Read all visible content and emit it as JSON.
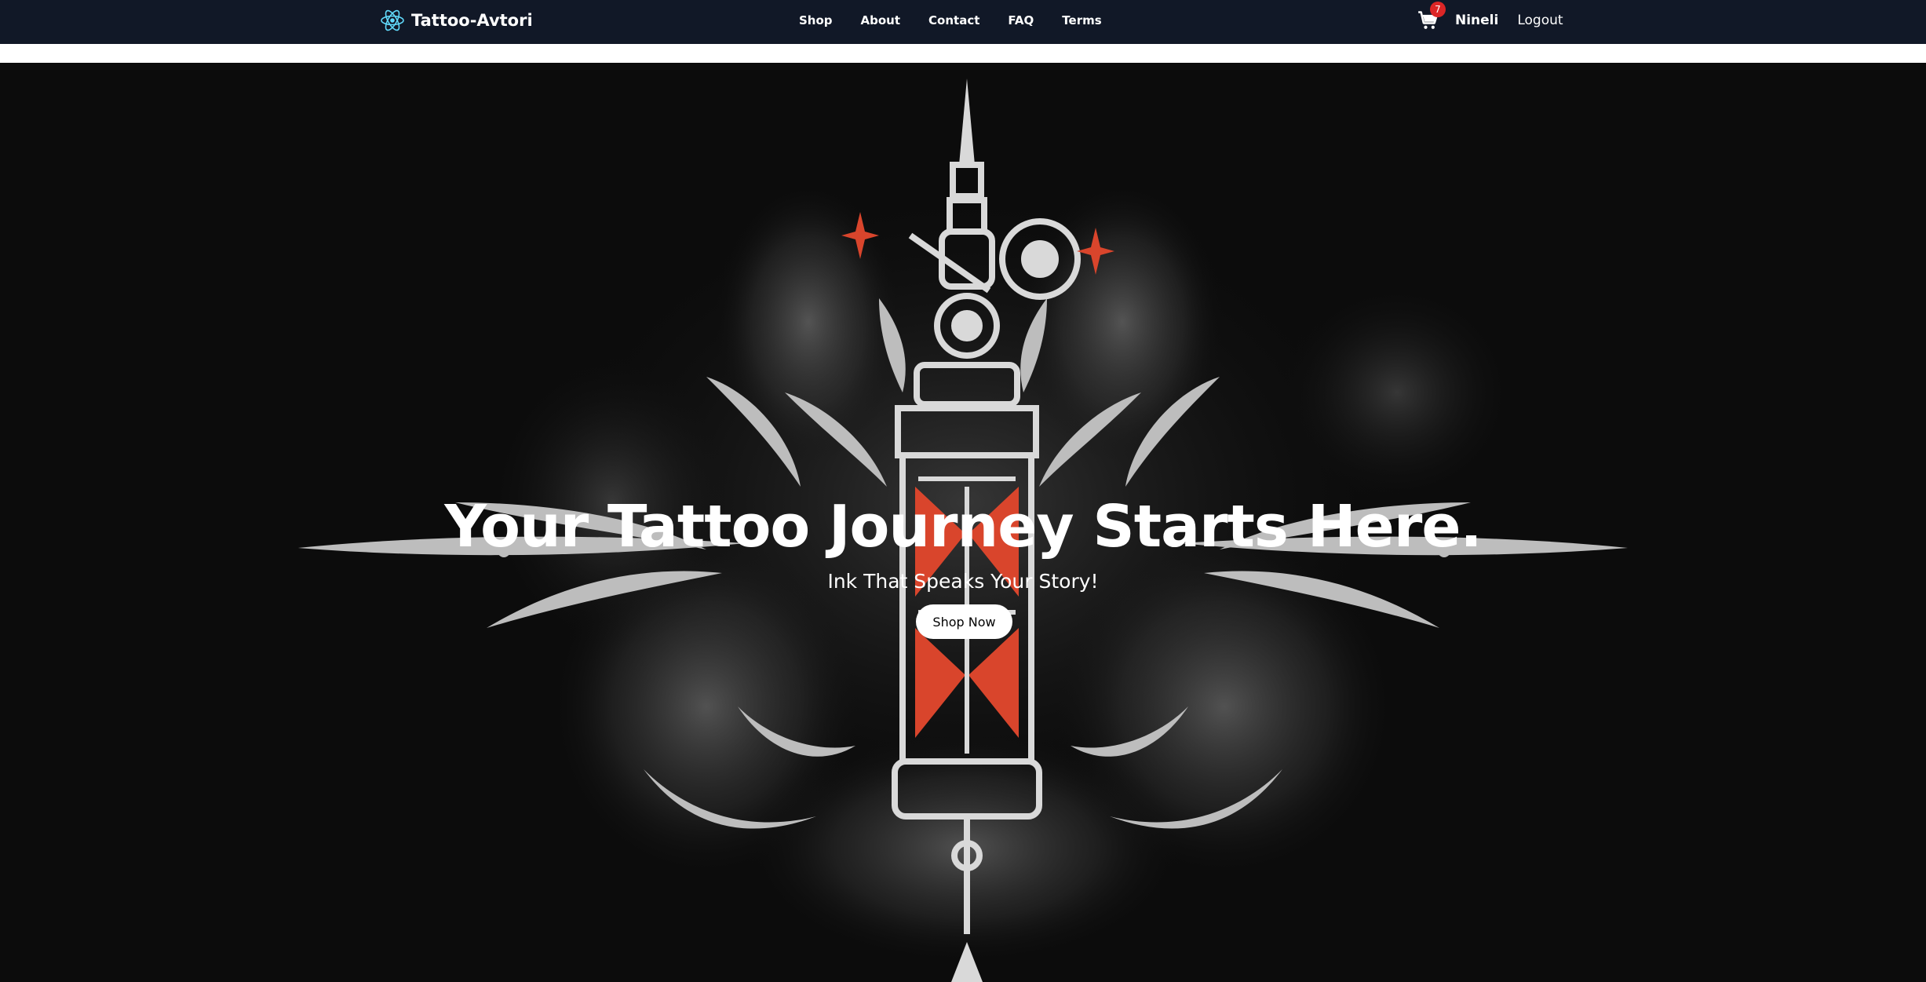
{
  "navbar": {
    "brand": "Tattoo-Avtori",
    "links": [
      "Shop",
      "About",
      "Contact",
      "FAQ",
      "Terms"
    ],
    "cart_count": "7",
    "username": "Nineli",
    "logout_label": "Logout"
  },
  "hero": {
    "title": "Your Tattoo Journey Starts Here.",
    "subtitle": "Ink That Speaks Your Story!",
    "cta_label": "Shop Now"
  },
  "colors": {
    "navbar_bg": "#111827",
    "hero_bg": "#0c0c0c",
    "accent_red": "#d9452c",
    "logo_blue": "#61dafb",
    "badge_red": "#dc2626"
  },
  "icons": [
    "react-atom-logo-icon",
    "cart-icon"
  ]
}
